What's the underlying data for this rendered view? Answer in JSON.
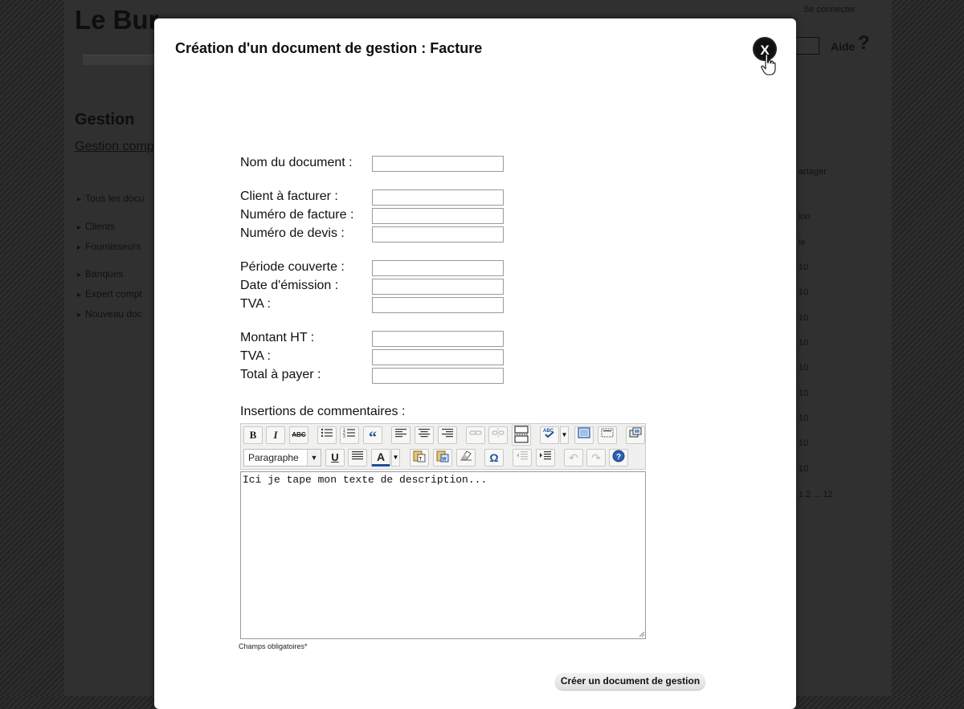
{
  "background_page": {
    "site_title": "Le Bur",
    "login_link": "Se connecter",
    "help_label": "Aide",
    "help_icon": "?",
    "section_heading": "Gestion",
    "breadcrumb_link": "Gestion comp",
    "nav_items": [
      "Tous les docu",
      "Clients",
      "Fournisseurs",
      "Banques",
      "Expert compt",
      "Nouveau doc"
    ],
    "right_items": [
      "artager",
      "ion",
      "ie",
      "10",
      "10",
      "10",
      "10",
      "10",
      "10",
      "10",
      "10",
      "10",
      "1 2 ... 12"
    ]
  },
  "modal": {
    "title": "Création d'un document de gestion : Facture",
    "close_label": "X",
    "fields": [
      {
        "label": "Nom du document :",
        "value": ""
      },
      {
        "label": "Client à facturer :",
        "value": ""
      },
      {
        "label": "Numéro de facture :",
        "value": ""
      },
      {
        "label": "Numéro de devis :",
        "value": ""
      },
      {
        "label": "Période couverte :",
        "value": ""
      },
      {
        "label": "Date d'émission :",
        "value": ""
      },
      {
        "label": "TVA :",
        "value": ""
      },
      {
        "label": "Montant HT :",
        "value": ""
      },
      {
        "label": "TVA :",
        "value": ""
      },
      {
        "label": "Total à payer :",
        "value": ""
      }
    ],
    "comments_label": "Insertions de commentaires :",
    "editor": {
      "format_select": "Paragraphe",
      "content": "Ici je tape mon texte de description...",
      "toolbar_row1": [
        "bold-icon",
        "italic-icon",
        "strikethrough-icon",
        "bullet-list-icon",
        "numbered-list-icon",
        "blockquote-icon",
        "align-left-icon",
        "align-center-icon",
        "align-right-icon",
        "link-icon",
        "unlink-icon",
        "page-break-icon",
        "spellcheck-icon",
        "fullscreen-icon",
        "visual-aid-icon",
        "media-icon"
      ],
      "toolbar_row2": [
        "underline-icon",
        "justify-icon",
        "text-color-icon",
        "paste-text-icon",
        "paste-word-icon",
        "remove-format-icon",
        "special-char-icon",
        "outdent-icon",
        "indent-icon",
        "undo-icon",
        "redo-icon",
        "help-icon"
      ],
      "bold_glyph": "B",
      "italic_glyph": "I",
      "strike_glyph": "ABC",
      "underline_glyph": "U",
      "text_color_glyph": "A",
      "omega_glyph": "Ω",
      "help_glyph": "?",
      "quote_glyph": "“"
    },
    "required_note": "Champs obligatoires*",
    "submit_label": "Créer un document de gestion"
  }
}
